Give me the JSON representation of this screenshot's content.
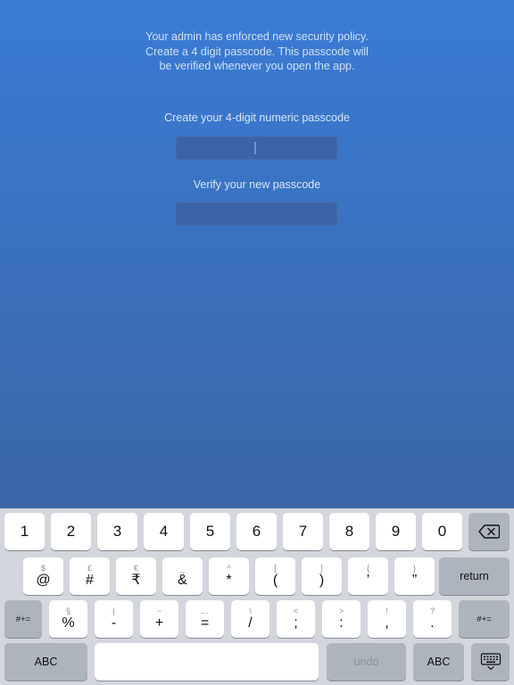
{
  "policy": {
    "line1": "Your admin has enforced new security policy.",
    "line2": "Create a 4 digit passcode. This passcode will",
    "line3": "be verified whenever you open the app."
  },
  "create": {
    "label": "Create your 4-digit numeric passcode"
  },
  "verify": {
    "label": "Verify your new passcode"
  },
  "keyboard": {
    "row1": [
      "1",
      "2",
      "3",
      "4",
      "5",
      "6",
      "7",
      "8",
      "9",
      "0"
    ],
    "row2": [
      {
        "alt": "$",
        "main": "@"
      },
      {
        "alt": "£",
        "main": "#"
      },
      {
        "alt": "€",
        "main": "₹"
      },
      {
        "alt": "_",
        "main": "&"
      },
      {
        "alt": "^",
        "main": "*"
      },
      {
        "alt": "[",
        "main": "("
      },
      {
        "alt": "]",
        "main": ")"
      },
      {
        "alt": "{",
        "main": "’"
      },
      {
        "alt": "}",
        "main": "”"
      }
    ],
    "row3": [
      {
        "alt": "§",
        "main": "%"
      },
      {
        "alt": "|",
        "main": "-"
      },
      {
        "alt": "~",
        "main": "+"
      },
      {
        "alt": "…",
        "main": "="
      },
      {
        "alt": "\\",
        "main": "/"
      },
      {
        "alt": "<",
        "main": ";"
      },
      {
        "alt": ">",
        "main": ":"
      },
      {
        "alt": "!",
        "main": ","
      },
      {
        "alt": "?",
        "main": "."
      }
    ],
    "return_label": "return",
    "symbols_label": "#+=",
    "abc_label": "ABC",
    "undo_label": "undo",
    "colors": {
      "background": "#d3d6dc",
      "key": "#ffffff",
      "special_key": "#adb4be"
    }
  }
}
